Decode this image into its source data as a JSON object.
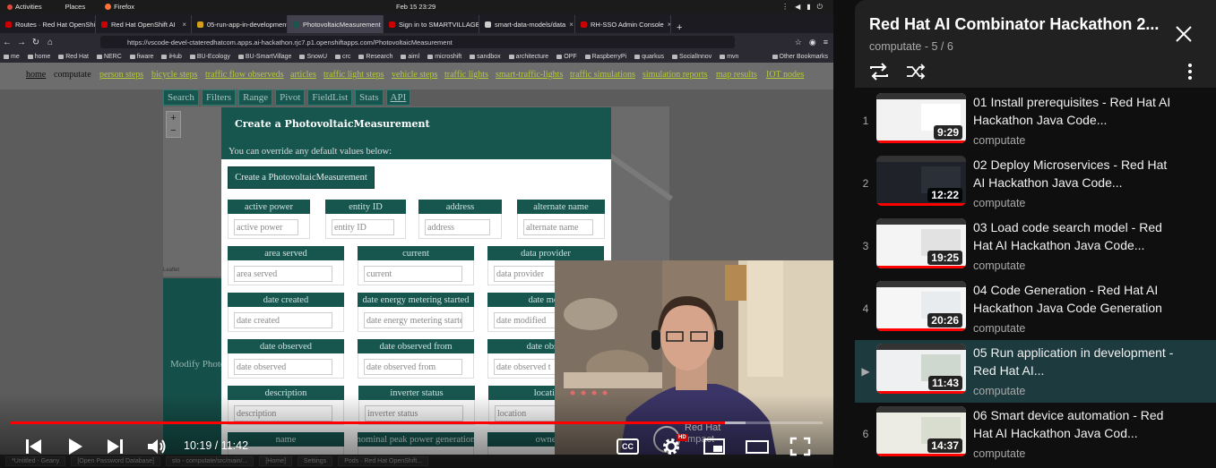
{
  "gnome": {
    "activities": "Activities",
    "places": "Places",
    "app": "Firefox",
    "clock": "Feb 15  23:29"
  },
  "browser": {
    "tabs": [
      {
        "label": "Routes · Red Hat OpenShift",
        "color": "#cc0000"
      },
      {
        "label": "Red Hat OpenShift AI",
        "color": "#cc0000"
      },
      {
        "label": "05-run-app-in-development",
        "color": "#d4a017"
      },
      {
        "label": "PhotovoltaicMeasurement",
        "color": "#17564f"
      },
      {
        "label": "Sign in to SMARTVILLAGE",
        "color": "#cc0000"
      },
      {
        "label": "smart-data-models/data",
        "color": "#cccccc"
      },
      {
        "label": "RH-SSO Admin Console",
        "color": "#cc0000"
      }
    ],
    "url": "https://vscode-devel-ctateredhatcom.apps.ai-hackathon.rjc7.p1.openshiftapps.com/PhotovoltaicMeasurement",
    "bookmarks": [
      "me",
      "home",
      "Red Hat",
      "NERC",
      "fiware",
      "iHub",
      "BU-Ecology",
      "BU-SmartVillage",
      "SnowU",
      "crc",
      "Research",
      "aiml",
      "microshift",
      "sandbox",
      "architecture",
      "OPF",
      "RaspberryPi",
      "quarkus",
      "SocialInnov",
      "mvn"
    ],
    "other_bookmarks": "Other Bookmarks"
  },
  "site": {
    "nav": [
      {
        "label": "home",
        "kind": "home"
      },
      {
        "label": "computate",
        "kind": "cur"
      },
      {
        "label": "person steps",
        "kind": "lnk"
      },
      {
        "label": "bicycle steps",
        "kind": "lnk"
      },
      {
        "label": "traffic flow observeds",
        "kind": "lnk"
      },
      {
        "label": "articles",
        "kind": "lnk"
      },
      {
        "label": "traffic light steps",
        "kind": "lnk"
      },
      {
        "label": "vehicle steps",
        "kind": "lnk"
      },
      {
        "label": "traffic lights",
        "kind": "lnk"
      },
      {
        "label": "smart-traffic-lights",
        "kind": "lnk"
      },
      {
        "label": "traffic simulations",
        "kind": "lnk"
      },
      {
        "label": "simulation reports",
        "kind": "lnk"
      },
      {
        "label": "map results",
        "kind": "lnk"
      },
      {
        "label": "IOT nodes",
        "kind": "lnk"
      }
    ],
    "search_buttons": [
      "Search",
      "Filters",
      "Range",
      "Pivot",
      "FieldList",
      "Stats",
      "API"
    ],
    "zoom_in": "+",
    "zoom_out": "−",
    "leaflet": "Leaflet",
    "modify_label": "Modify Photo"
  },
  "modal": {
    "title": "Create a PhotovoltaicMeasurement",
    "subtitle": "You can override any default values below:",
    "create_button": "Create a PhotovoltaicMeasurement",
    "fields": [
      {
        "label": "active power",
        "placeholder": "active power"
      },
      {
        "label": "entity ID",
        "placeholder": "entity ID"
      },
      {
        "label": "address",
        "placeholder": "address"
      },
      {
        "label": "alternate name",
        "placeholder": "alternate name"
      },
      {
        "label": "area served",
        "placeholder": "area served"
      },
      {
        "label": "current",
        "placeholder": "current"
      },
      {
        "label": "data provider",
        "placeholder": "data provider"
      },
      {
        "label": "date created",
        "placeholder": "date created"
      },
      {
        "label": "date energy metering started",
        "placeholder": "date energy metering starte"
      },
      {
        "label": "date mod",
        "placeholder": "date modified"
      },
      {
        "label": "date observed",
        "placeholder": "date observed"
      },
      {
        "label": "date observed from",
        "placeholder": "date observed from"
      },
      {
        "label": "date obser",
        "placeholder": "date observed t"
      },
      {
        "label": "description",
        "placeholder": "description"
      },
      {
        "label": "inverter status",
        "placeholder": "inverter status"
      },
      {
        "label": "locatio",
        "placeholder": "location"
      },
      {
        "label": "name",
        "placeholder": ""
      },
      {
        "label": "nominal peak power generation",
        "placeholder": ""
      },
      {
        "label": "owne",
        "placeholder": ""
      }
    ]
  },
  "taskbar": [
    "*Untitled - Geany",
    "[Open Password Database]",
    "sto - computate/src/main/...",
    "[Home]",
    "Settings",
    "Pods · Red Hat OpenShift..."
  ],
  "player": {
    "time": "10:19 / 11:42",
    "progress": 0.88,
    "loaded": 0.905,
    "cc_label": "CC",
    "hd_label": "HD"
  },
  "playlist": {
    "title": "Red Hat AI Combinator Hackathon 2...",
    "channel": "computate",
    "position": "5 / 6",
    "items": [
      {
        "index": "1",
        "title": "01 Install prerequisites - Red Hat AI Hackathon Java Code...",
        "duration": "9:29",
        "channel": "computate",
        "current": false
      },
      {
        "index": "2",
        "title": "02 Deploy Microservices - Red Hat AI Hackathon Java Code...",
        "duration": "12:22",
        "channel": "computate",
        "current": false
      },
      {
        "index": "3",
        "title": "03 Load code search model - Red Hat AI Hackathon Java Code...",
        "duration": "19:25",
        "channel": "computate",
        "current": false
      },
      {
        "index": "4",
        "title": "04 Code Generation - Red Hat AI Hackathon Java Code Generation",
        "duration": "20:26",
        "channel": "computate",
        "current": false
      },
      {
        "index": "▶",
        "title": "05 Run application in development - Red Hat AI...",
        "duration": "11:43",
        "channel": "computate",
        "current": true
      },
      {
        "index": "6",
        "title": "06 Smart device automation - Red Hat AI Hackathon Java Cod...",
        "duration": "14:37",
        "channel": "computate",
        "current": false
      }
    ]
  },
  "colors": {
    "accent": "#ff0000",
    "teal": "#17564f",
    "current_row": "#1d3a3f"
  }
}
